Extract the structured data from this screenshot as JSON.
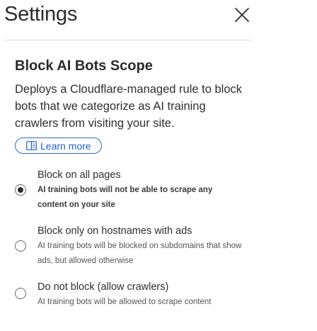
{
  "header": {
    "title": "Settings",
    "close_icon": "close-icon"
  },
  "section": {
    "title": "Block AI Bots Scope",
    "description": "Deploys a Cloudflare-managed rule to block bots that we categorize as AI training crawlers from visiting your site.",
    "learn_more": {
      "label": "Learn more",
      "icon": "book-icon"
    }
  },
  "options": [
    {
      "label": "Block on all pages",
      "description": "AI training bots will not be able to scrape any content on your site",
      "selected": true
    },
    {
      "label": "Block only on hostnames with ads",
      "description": "AI training bots will be blocked on subdomains that show ads, but allowed otherwise",
      "selected": false
    },
    {
      "label": "Do not block (allow crawlers)",
      "description": "AI training bots will be allowed to scrape content",
      "selected": false
    }
  ],
  "colors": {
    "accent": "#1f5fcf",
    "text": "#2f2f2f",
    "divider": "#d9d9d9"
  }
}
